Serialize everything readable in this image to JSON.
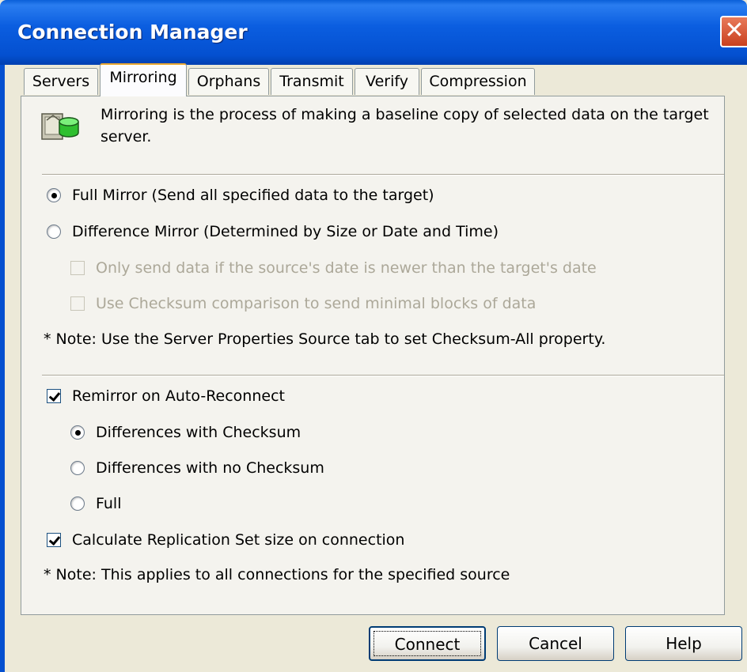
{
  "window": {
    "title": "Connection Manager",
    "close_label": "✕"
  },
  "tabs": [
    {
      "label": "Servers"
    },
    {
      "label": "Mirroring"
    },
    {
      "label": "Orphans"
    },
    {
      "label": "Transmit"
    },
    {
      "label": "Verify"
    },
    {
      "label": "Compression"
    }
  ],
  "active_tab": "Mirroring",
  "mirroring": {
    "description": "Mirroring is the process of making a baseline copy of selected data on the target",
    "description_line2": "server.",
    "icon": "database-server-icon",
    "full_mirror_label": "Full Mirror (Send all specified data to the target)",
    "difference_mirror_label": "Difference Mirror (Determined by Size or Date and Time)",
    "only_newer_label": "Only send data if the source's date is newer than the target's date",
    "checksum_label": "Use Checksum comparison to send minimal blocks of data",
    "note1": "* Note: Use the Server Properties Source tab to set Checksum-All property.",
    "remirror_label": "Remirror on Auto-Reconnect",
    "diff_checksum_label": "Differences with Checksum",
    "diff_no_checksum_label": "Differences with no Checksum",
    "full_label": "Full",
    "calc_label": "Calculate Replication Set size on connection",
    "note2": "* Note: This applies to all connections for the specified source",
    "selected_mirror_mode": "Full Mirror",
    "remirror_checked": true,
    "selected_remirror_mode": "Differences with Checksum",
    "calc_checked": true
  },
  "buttons": {
    "connect": "Connect",
    "cancel": "Cancel",
    "help": "Help"
  },
  "colors": {
    "titlebar": "#0450d0",
    "dialog_bg": "#ece9d8",
    "tab_highlight": "#e9a732"
  }
}
